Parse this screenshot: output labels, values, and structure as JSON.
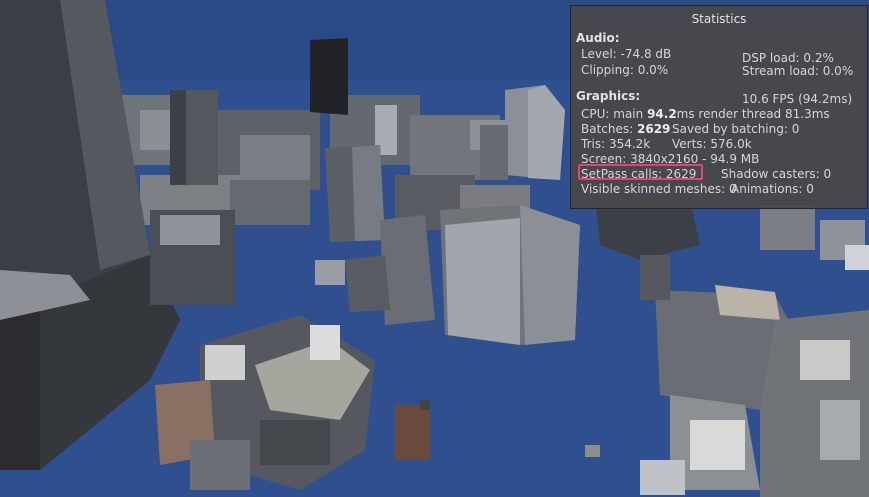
{
  "statistics": {
    "title": "Statistics",
    "audio": {
      "heading": "Audio:",
      "level": "Level: -74.8 dB",
      "clipping": "Clipping: 0.0%",
      "dsp_load": "DSP load: 0.2%",
      "stream_load": "Stream load: 0.0%"
    },
    "graphics": {
      "heading": "Graphics:",
      "fps": "10.6 FPS (94.2ms)",
      "cpu_prefix": "CPU: main ",
      "cpu_main": "94.2",
      "cpu_suffix": "ms  render thread 81.3ms",
      "batches_prefix": "Batches: ",
      "batches_value": "2629",
      "saved_by_batching": "Saved by batching: 0",
      "tris": "Tris: 354.2k",
      "verts": "Verts: 576.0k",
      "screen": "Screen: 3840x2160 - 94.9 MB",
      "setpass": "SetPass calls: 2629",
      "shadow_casters": "Shadow casters: 0",
      "visible_skinned_meshes": "Visible skinned meshes: 0",
      "animations": "Animations: 0"
    }
  },
  "colors": {
    "ground": "#2f4f8f",
    "panel_bg": "#484848",
    "highlight": "#e0447a"
  }
}
